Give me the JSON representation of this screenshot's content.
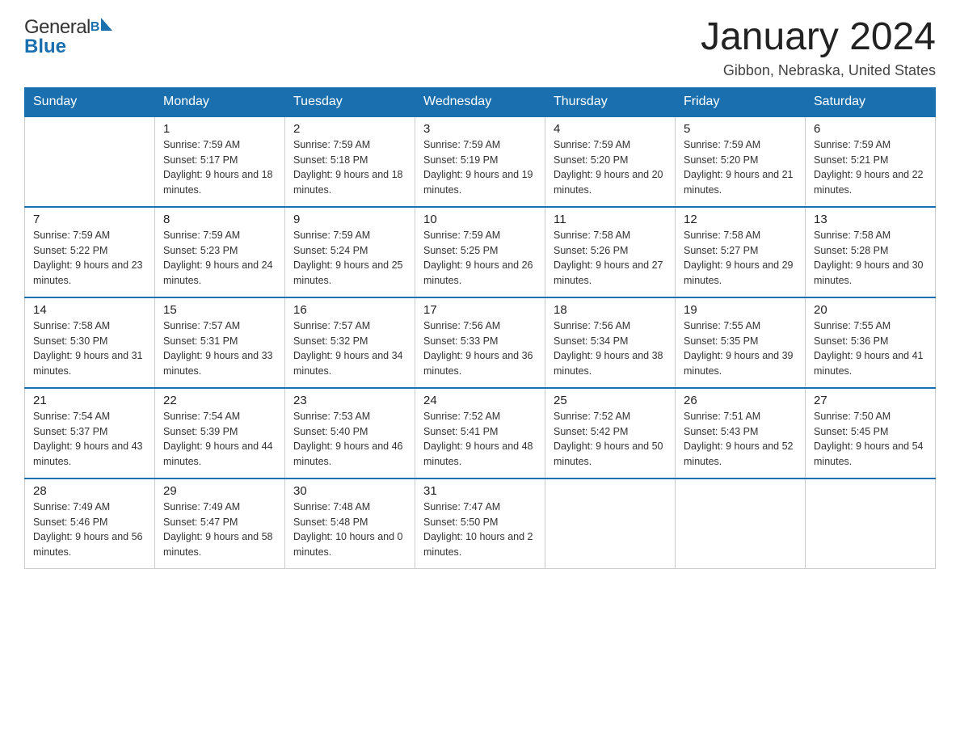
{
  "header": {
    "logo_general": "General",
    "logo_b": "B",
    "logo_blue": "Blue",
    "month_title": "January 2024",
    "location": "Gibbon, Nebraska, United States"
  },
  "calendar": {
    "days_of_week": [
      "Sunday",
      "Monday",
      "Tuesday",
      "Wednesday",
      "Thursday",
      "Friday",
      "Saturday"
    ],
    "weeks": [
      [
        {
          "day": "",
          "sunrise": "",
          "sunset": "",
          "daylight": ""
        },
        {
          "day": "1",
          "sunrise": "Sunrise: 7:59 AM",
          "sunset": "Sunset: 5:17 PM",
          "daylight": "Daylight: 9 hours and 18 minutes."
        },
        {
          "day": "2",
          "sunrise": "Sunrise: 7:59 AM",
          "sunset": "Sunset: 5:18 PM",
          "daylight": "Daylight: 9 hours and 18 minutes."
        },
        {
          "day": "3",
          "sunrise": "Sunrise: 7:59 AM",
          "sunset": "Sunset: 5:19 PM",
          "daylight": "Daylight: 9 hours and 19 minutes."
        },
        {
          "day": "4",
          "sunrise": "Sunrise: 7:59 AM",
          "sunset": "Sunset: 5:20 PM",
          "daylight": "Daylight: 9 hours and 20 minutes."
        },
        {
          "day": "5",
          "sunrise": "Sunrise: 7:59 AM",
          "sunset": "Sunset: 5:20 PM",
          "daylight": "Daylight: 9 hours and 21 minutes."
        },
        {
          "day": "6",
          "sunrise": "Sunrise: 7:59 AM",
          "sunset": "Sunset: 5:21 PM",
          "daylight": "Daylight: 9 hours and 22 minutes."
        }
      ],
      [
        {
          "day": "7",
          "sunrise": "Sunrise: 7:59 AM",
          "sunset": "Sunset: 5:22 PM",
          "daylight": "Daylight: 9 hours and 23 minutes."
        },
        {
          "day": "8",
          "sunrise": "Sunrise: 7:59 AM",
          "sunset": "Sunset: 5:23 PM",
          "daylight": "Daylight: 9 hours and 24 minutes."
        },
        {
          "day": "9",
          "sunrise": "Sunrise: 7:59 AM",
          "sunset": "Sunset: 5:24 PM",
          "daylight": "Daylight: 9 hours and 25 minutes."
        },
        {
          "day": "10",
          "sunrise": "Sunrise: 7:59 AM",
          "sunset": "Sunset: 5:25 PM",
          "daylight": "Daylight: 9 hours and 26 minutes."
        },
        {
          "day": "11",
          "sunrise": "Sunrise: 7:58 AM",
          "sunset": "Sunset: 5:26 PM",
          "daylight": "Daylight: 9 hours and 27 minutes."
        },
        {
          "day": "12",
          "sunrise": "Sunrise: 7:58 AM",
          "sunset": "Sunset: 5:27 PM",
          "daylight": "Daylight: 9 hours and 29 minutes."
        },
        {
          "day": "13",
          "sunrise": "Sunrise: 7:58 AM",
          "sunset": "Sunset: 5:28 PM",
          "daylight": "Daylight: 9 hours and 30 minutes."
        }
      ],
      [
        {
          "day": "14",
          "sunrise": "Sunrise: 7:58 AM",
          "sunset": "Sunset: 5:30 PM",
          "daylight": "Daylight: 9 hours and 31 minutes."
        },
        {
          "day": "15",
          "sunrise": "Sunrise: 7:57 AM",
          "sunset": "Sunset: 5:31 PM",
          "daylight": "Daylight: 9 hours and 33 minutes."
        },
        {
          "day": "16",
          "sunrise": "Sunrise: 7:57 AM",
          "sunset": "Sunset: 5:32 PM",
          "daylight": "Daylight: 9 hours and 34 minutes."
        },
        {
          "day": "17",
          "sunrise": "Sunrise: 7:56 AM",
          "sunset": "Sunset: 5:33 PM",
          "daylight": "Daylight: 9 hours and 36 minutes."
        },
        {
          "day": "18",
          "sunrise": "Sunrise: 7:56 AM",
          "sunset": "Sunset: 5:34 PM",
          "daylight": "Daylight: 9 hours and 38 minutes."
        },
        {
          "day": "19",
          "sunrise": "Sunrise: 7:55 AM",
          "sunset": "Sunset: 5:35 PM",
          "daylight": "Daylight: 9 hours and 39 minutes."
        },
        {
          "day": "20",
          "sunrise": "Sunrise: 7:55 AM",
          "sunset": "Sunset: 5:36 PM",
          "daylight": "Daylight: 9 hours and 41 minutes."
        }
      ],
      [
        {
          "day": "21",
          "sunrise": "Sunrise: 7:54 AM",
          "sunset": "Sunset: 5:37 PM",
          "daylight": "Daylight: 9 hours and 43 minutes."
        },
        {
          "day": "22",
          "sunrise": "Sunrise: 7:54 AM",
          "sunset": "Sunset: 5:39 PM",
          "daylight": "Daylight: 9 hours and 44 minutes."
        },
        {
          "day": "23",
          "sunrise": "Sunrise: 7:53 AM",
          "sunset": "Sunset: 5:40 PM",
          "daylight": "Daylight: 9 hours and 46 minutes."
        },
        {
          "day": "24",
          "sunrise": "Sunrise: 7:52 AM",
          "sunset": "Sunset: 5:41 PM",
          "daylight": "Daylight: 9 hours and 48 minutes."
        },
        {
          "day": "25",
          "sunrise": "Sunrise: 7:52 AM",
          "sunset": "Sunset: 5:42 PM",
          "daylight": "Daylight: 9 hours and 50 minutes."
        },
        {
          "day": "26",
          "sunrise": "Sunrise: 7:51 AM",
          "sunset": "Sunset: 5:43 PM",
          "daylight": "Daylight: 9 hours and 52 minutes."
        },
        {
          "day": "27",
          "sunrise": "Sunrise: 7:50 AM",
          "sunset": "Sunset: 5:45 PM",
          "daylight": "Daylight: 9 hours and 54 minutes."
        }
      ],
      [
        {
          "day": "28",
          "sunrise": "Sunrise: 7:49 AM",
          "sunset": "Sunset: 5:46 PM",
          "daylight": "Daylight: 9 hours and 56 minutes."
        },
        {
          "day": "29",
          "sunrise": "Sunrise: 7:49 AM",
          "sunset": "Sunset: 5:47 PM",
          "daylight": "Daylight: 9 hours and 58 minutes."
        },
        {
          "day": "30",
          "sunrise": "Sunrise: 7:48 AM",
          "sunset": "Sunset: 5:48 PM",
          "daylight": "Daylight: 10 hours and 0 minutes."
        },
        {
          "day": "31",
          "sunrise": "Sunrise: 7:47 AM",
          "sunset": "Sunset: 5:50 PM",
          "daylight": "Daylight: 10 hours and 2 minutes."
        },
        {
          "day": "",
          "sunrise": "",
          "sunset": "",
          "daylight": ""
        },
        {
          "day": "",
          "sunrise": "",
          "sunset": "",
          "daylight": ""
        },
        {
          "day": "",
          "sunrise": "",
          "sunset": "",
          "daylight": ""
        }
      ]
    ]
  }
}
